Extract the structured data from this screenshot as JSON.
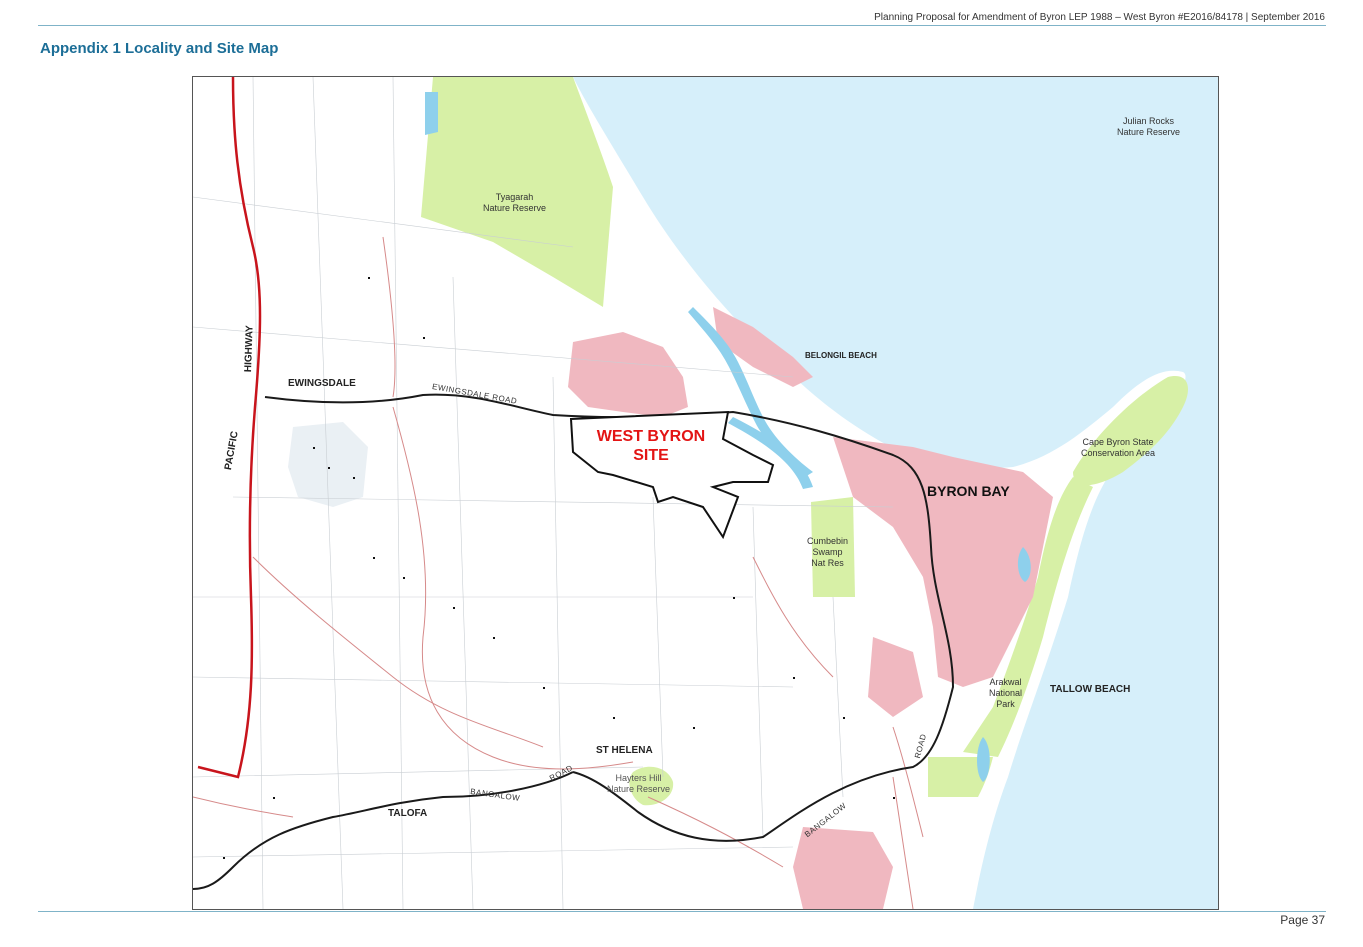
{
  "header": {
    "document_title": "Planning Proposal for Amendment of Byron LEP 1988 – West Byron #E2016/84178 | September 2016"
  },
  "page": {
    "appendix_title": "Appendix 1 Locality and Site Map",
    "page_number": "Page 37"
  },
  "map": {
    "site_label_line1": "WEST BYRON",
    "site_label_line2": "SITE",
    "places": {
      "byron_bay": "BYRON BAY",
      "ewingsdale": "EWINGSDALE",
      "st_helena": "ST HELENA",
      "talofa": "TALOFA",
      "belongil_beach": "BELONGIL BEACH",
      "tallow_beach": "TALLOW BEACH"
    },
    "reserves": {
      "tyagarah_l1": "Tyagarah",
      "tyagarah_l2": "Nature Reserve",
      "julian_l1": "Julian Rocks",
      "julian_l2": "Nature Reserve",
      "cape_l1": "Cape Byron State",
      "cape_l2": "Conservation Area",
      "cumbebin_l1": "Cumbebin",
      "cumbebin_l2": "Swamp",
      "cumbebin_l3": "Nat Res",
      "arakwal_l1": "Arakwal",
      "arakwal_l2": "National",
      "arakwal_l3": "Park",
      "hayters_l1": "Hayters Hill",
      "hayters_l2": "Nature Reserve"
    },
    "roads": {
      "ewingsdale_road": "EWINGSDALE ROAD",
      "pacific": "PACIFIC",
      "highway": "HIGHWAY",
      "bangalow_a": "BANGALOW",
      "road_a": "ROAD",
      "bangalow_b": "BANGALOW",
      "road_b": "ROAD"
    },
    "colors": {
      "ocean": "#d6effa",
      "reserve": "#d7f0a6",
      "urban": "#f0b8c0",
      "highway": "#c8141c",
      "main_road": "#1a1a1a",
      "local_road": "#d68a8a",
      "site_label": "#e31414",
      "water": "#8ed0ec"
    }
  }
}
